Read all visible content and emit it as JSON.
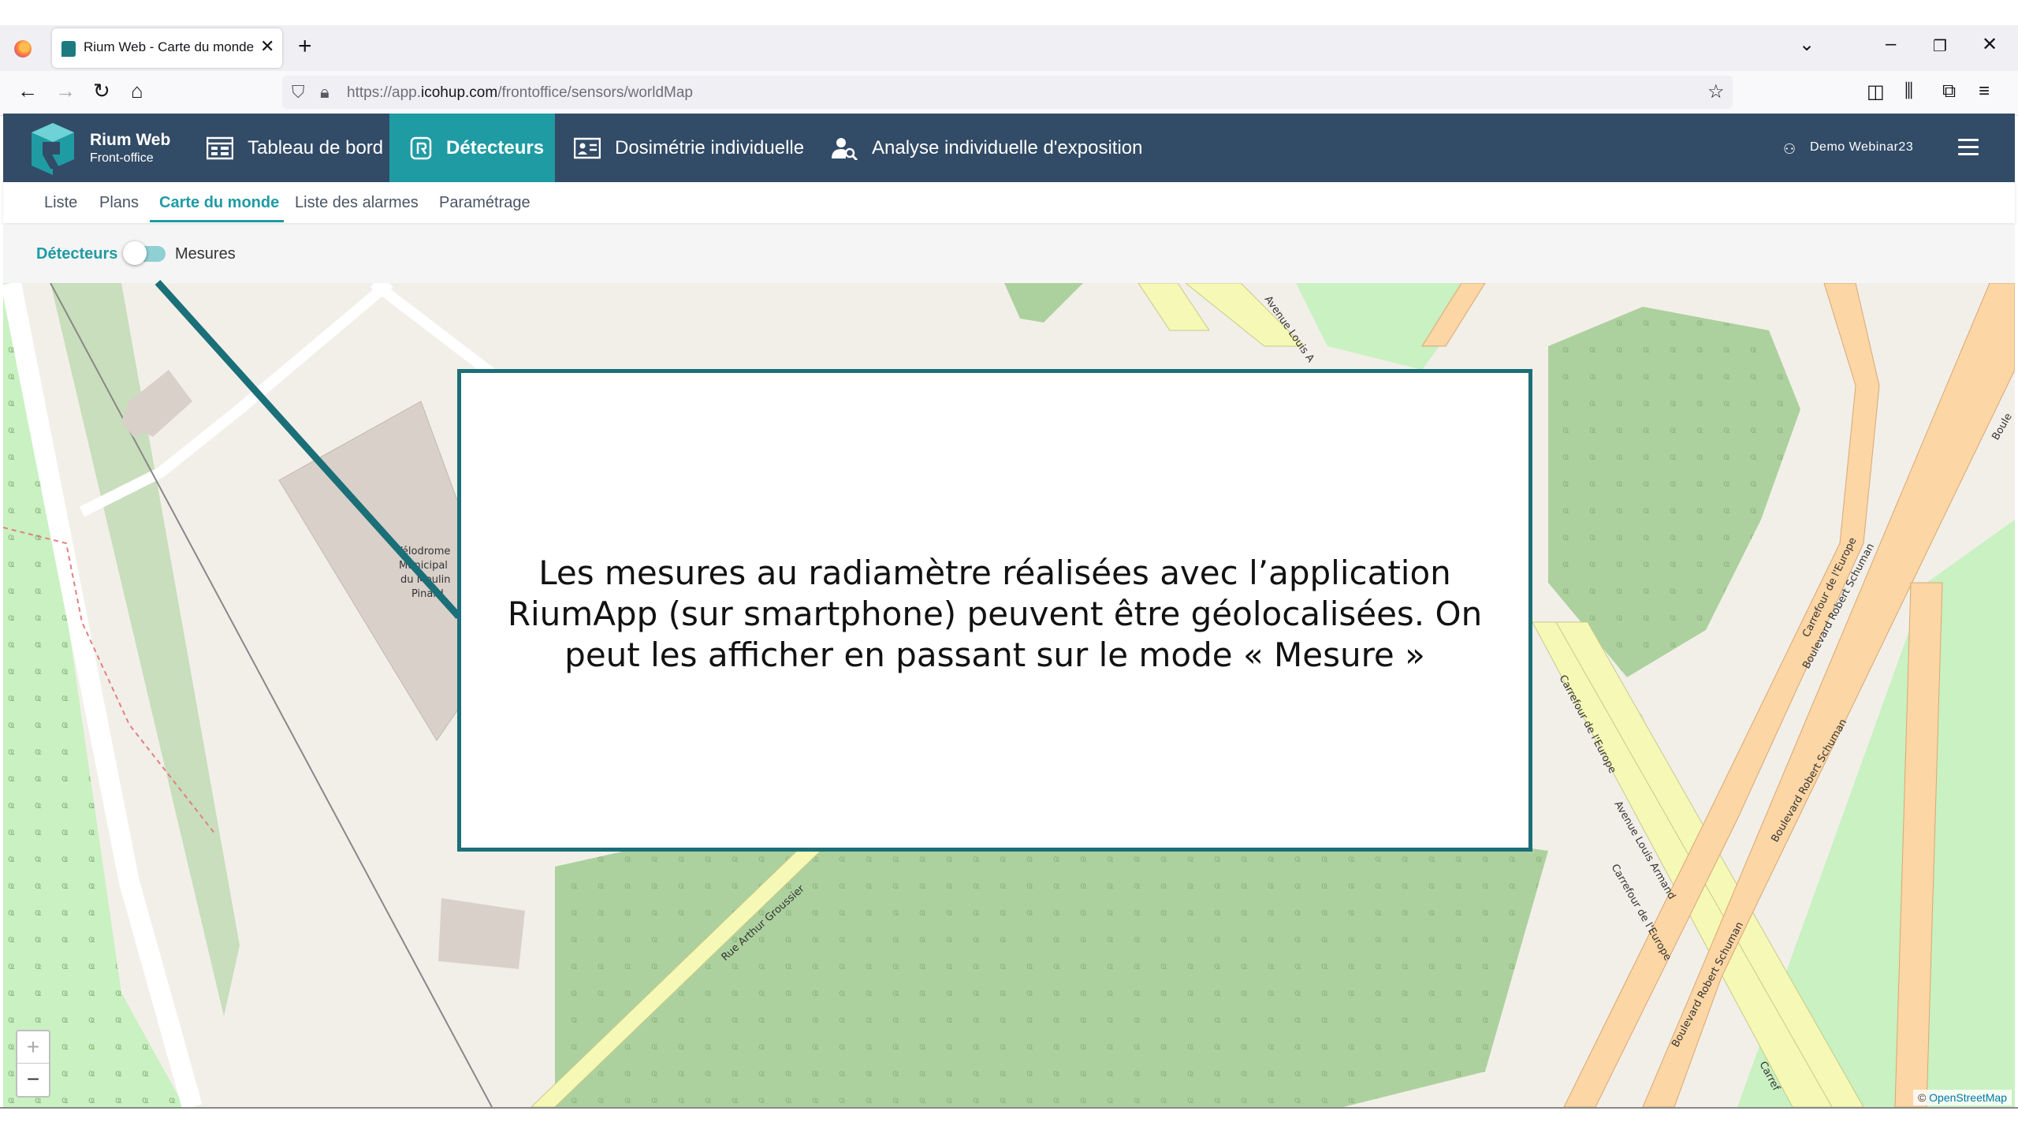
{
  "browser": {
    "tab_title": "Rium Web - Carte du monde",
    "url_prefix": "https://app.",
    "url_domain": "icohup.com",
    "url_path": "/frontoffice/sensors/worldMap"
  },
  "app": {
    "brand_name": "Rium Web",
    "brand_sub": "Front-office",
    "menu": [
      {
        "label": "Tableau de bord",
        "icon": "dashboard-icon"
      },
      {
        "label": "Détecteurs",
        "icon": "detector-icon",
        "active": true
      },
      {
        "label": "Dosimétrie individuelle",
        "icon": "id-card-icon"
      },
      {
        "label": "Analyse individuelle d'exposition",
        "icon": "user-search-icon"
      }
    ],
    "user": "Demo Webinar23"
  },
  "subnav": {
    "items": [
      "Liste",
      "Plans",
      "Carte du monde",
      "Liste des alarmes",
      "Paramétrage"
    ],
    "active": "Carte du monde"
  },
  "toggle": {
    "left_label": "Détecteurs",
    "right_label": "Mesures"
  },
  "map": {
    "labels": {
      "velodrome": [
        "Vélodrome",
        "Municipal",
        "du Moulin",
        "Pinard"
      ],
      "rue_arthur": "Rue Arthur Groussier",
      "avenue_louis_top": "Avenue Louis A",
      "carrefour_1": "Carrefour de l'Europe",
      "avenue_louis_armand": "Avenue Louis Armand",
      "carrefour_2": "Carrefour de l'Europe",
      "bd_schuman_1": "Boulevard Robert Schuman",
      "bd_schuman_2": "Boulevard Robert Schuman",
      "bd_schuman_3": "Boulevard Robert Schuman",
      "carrefour_3": "Carrefour de l'Europe",
      "carrefour_4": "Carref",
      "boule": "Boule"
    },
    "zoom_in": "+",
    "zoom_out": "−",
    "attribution_prefix": "© ",
    "attribution_link": "OpenStreetMap"
  },
  "overlay": {
    "text": "Les mesures au radiamètre réalisées avec l’application RiumApp (sur smartphone) peuvent être géolocalisées. On peut les afficher en passant sur le mode « Mesure »"
  },
  "colors": {
    "header_bg": "#324b66",
    "accent": "#1f9ba3",
    "overlay_border": "#1b6f78"
  }
}
